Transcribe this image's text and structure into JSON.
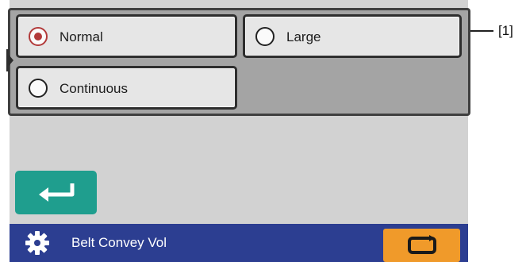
{
  "options": [
    {
      "label": "Normal",
      "selected": true
    },
    {
      "label": "Large",
      "selected": false
    },
    {
      "label": "Continuous",
      "selected": false
    }
  ],
  "callout": "[1]",
  "bottom_bar": {
    "title": "Belt Convey Vol",
    "icons": [
      "gear-icon",
      "belt-conveyor-icon"
    ]
  },
  "enter_button": {
    "icon": "enter-arrow-icon"
  },
  "colors": {
    "panel": "#a4a4a4",
    "background": "#d2d2d2",
    "enter_button": "#1f9e8e",
    "bottom_bar": "#2c3e91",
    "belt_button": "#f09a2a",
    "radio_selected": "#b23a3a"
  }
}
